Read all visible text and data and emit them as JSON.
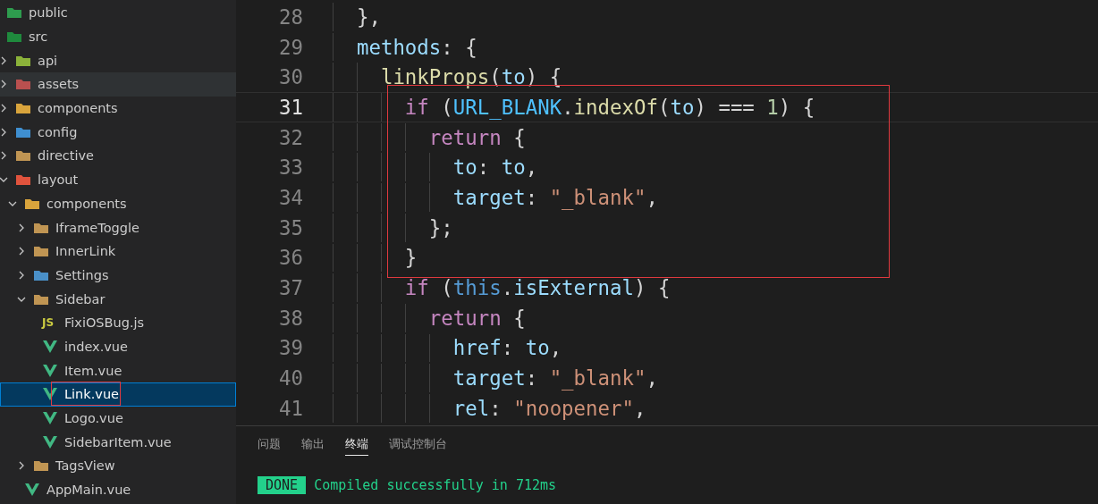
{
  "explorer": {
    "tree": [
      {
        "label": "public",
        "kind": "folder",
        "color": "#2e9c4e",
        "selected": false
      },
      {
        "label": "src",
        "kind": "folder",
        "color": "#1f8a3d",
        "selected": false,
        "children": [
          {
            "label": "api",
            "kind": "folder",
            "color": "#8bb23a",
            "expanded": false,
            "selected": false
          },
          {
            "label": "assets",
            "kind": "folder",
            "color": "#b9504f",
            "expanded": false,
            "selected": false,
            "hovered": true
          },
          {
            "label": "components",
            "kind": "folder",
            "color": "#d9a43c",
            "expanded": false,
            "selected": false
          },
          {
            "label": "config",
            "kind": "folder",
            "color": "#3f8fd0",
            "expanded": false,
            "selected": false
          },
          {
            "label": "directive",
            "kind": "folder",
            "color": "#c09553",
            "expanded": false,
            "selected": false
          },
          {
            "label": "layout",
            "kind": "folder",
            "color": "#e0533d",
            "expanded": true,
            "selected": false,
            "children": [
              {
                "label": "components",
                "kind": "folder",
                "color": "#d9a43c",
                "expanded": true,
                "selected": false,
                "children": [
                  {
                    "label": "IframeToggle",
                    "kind": "folder",
                    "color": "#c09553",
                    "expanded": false,
                    "selected": false
                  },
                  {
                    "label": "InnerLink",
                    "kind": "folder",
                    "color": "#c09553",
                    "expanded": false,
                    "selected": false
                  },
                  {
                    "label": "Settings",
                    "kind": "folder",
                    "color": "#4a90c8",
                    "expanded": false,
                    "selected": false
                  },
                  {
                    "label": "Sidebar",
                    "kind": "folder",
                    "color": "#c09553",
                    "expanded": true,
                    "selected": false,
                    "children": [
                      {
                        "label": "FixiOSBug.js",
                        "kind": "js",
                        "badge": "JS",
                        "selected": false
                      },
                      {
                        "label": "index.vue",
                        "kind": "vue",
                        "selected": false
                      },
                      {
                        "label": "Item.vue",
                        "kind": "vue",
                        "selected": false
                      },
                      {
                        "label": "Link.vue",
                        "kind": "vue",
                        "selected": true
                      },
                      {
                        "label": "Logo.vue",
                        "kind": "vue",
                        "selected": false
                      },
                      {
                        "label": "SidebarItem.vue",
                        "kind": "vue",
                        "selected": false
                      }
                    ]
                  },
                  {
                    "label": "TagsView",
                    "kind": "folder",
                    "color": "#c09553",
                    "expanded": false,
                    "selected": false
                  }
                ]
              },
              {
                "label": "AppMain.vue",
                "kind": "vue",
                "selected": false
              }
            ]
          }
        ]
      }
    ]
  },
  "editor": {
    "lines": [
      {
        "number": "28",
        "current": false,
        "tokens": [
          {
            "kind": "punct",
            "text": "},"
          }
        ]
      },
      {
        "number": "29",
        "current": false,
        "tokens": [
          {
            "kind": "prop",
            "text": "methods"
          },
          {
            "kind": "punct",
            "text": ": {"
          }
        ],
        "children": [
          {
            "number": "30",
            "current": false,
            "tokens": [
              {
                "kind": "func",
                "text": "linkProps"
              },
              {
                "kind": "punct",
                "text": "("
              },
              {
                "kind": "var",
                "text": "to"
              },
              {
                "kind": "punct",
                "text": ") {"
              }
            ],
            "children": [
              {
                "number": "31",
                "current": true,
                "tokens": [
                  {
                    "kind": "keyword",
                    "text": "if"
                  },
                  {
                    "kind": "punct",
                    "text": " ("
                  },
                  {
                    "kind": "const",
                    "text": "URL_BLANK"
                  },
                  {
                    "kind": "punct",
                    "text": "."
                  },
                  {
                    "kind": "func",
                    "text": "indexOf"
                  },
                  {
                    "kind": "punct",
                    "text": "("
                  },
                  {
                    "kind": "var",
                    "text": "to"
                  },
                  {
                    "kind": "punct",
                    "text": ") === "
                  },
                  {
                    "kind": "number",
                    "text": "1"
                  },
                  {
                    "kind": "punct",
                    "text": ") {"
                  }
                ],
                "children": [
                  {
                    "number": "32",
                    "current": false,
                    "tokens": [
                      {
                        "kind": "keyword",
                        "text": "return"
                      },
                      {
                        "kind": "punct",
                        "text": " {"
                      }
                    ],
                    "children": [
                      {
                        "number": "33",
                        "current": false,
                        "tokens": [
                          {
                            "kind": "prop",
                            "text": "to"
                          },
                          {
                            "kind": "punct",
                            "text": ": "
                          },
                          {
                            "kind": "var",
                            "text": "to"
                          },
                          {
                            "kind": "punct",
                            "text": ","
                          }
                        ]
                      },
                      {
                        "number": "34",
                        "current": false,
                        "tokens": [
                          {
                            "kind": "prop",
                            "text": "target"
                          },
                          {
                            "kind": "punct",
                            "text": ": "
                          },
                          {
                            "kind": "string",
                            "text": "\"_blank\""
                          },
                          {
                            "kind": "punct",
                            "text": ","
                          }
                        ]
                      }
                    ]
                  },
                  {
                    "number": "35",
                    "current": false,
                    "tokens": [
                      {
                        "kind": "punct",
                        "text": "};"
                      }
                    ]
                  }
                ]
              },
              {
                "number": "36",
                "current": false,
                "tokens": [
                  {
                    "kind": "punct",
                    "text": "}"
                  }
                ]
              },
              {
                "number": "37",
                "current": false,
                "tokens": [
                  {
                    "kind": "keyword",
                    "text": "if"
                  },
                  {
                    "kind": "punct",
                    "text": " ("
                  },
                  {
                    "kind": "this",
                    "text": "this"
                  },
                  {
                    "kind": "punct",
                    "text": "."
                  },
                  {
                    "kind": "var",
                    "text": "isExternal"
                  },
                  {
                    "kind": "punct",
                    "text": ") {"
                  }
                ],
                "children": [
                  {
                    "number": "38",
                    "current": false,
                    "tokens": [
                      {
                        "kind": "keyword",
                        "text": "return"
                      },
                      {
                        "kind": "punct",
                        "text": " {"
                      }
                    ],
                    "children": [
                      {
                        "number": "39",
                        "current": false,
                        "tokens": [
                          {
                            "kind": "prop",
                            "text": "href"
                          },
                          {
                            "kind": "punct",
                            "text": ": "
                          },
                          {
                            "kind": "var",
                            "text": "to"
                          },
                          {
                            "kind": "punct",
                            "text": ","
                          }
                        ]
                      },
                      {
                        "number": "40",
                        "current": false,
                        "tokens": [
                          {
                            "kind": "prop",
                            "text": "target"
                          },
                          {
                            "kind": "punct",
                            "text": ": "
                          },
                          {
                            "kind": "string",
                            "text": "\"_blank\""
                          },
                          {
                            "kind": "punct",
                            "text": ","
                          }
                        ]
                      },
                      {
                        "number": "41",
                        "current": false,
                        "tokens": [
                          {
                            "kind": "prop",
                            "text": "rel"
                          },
                          {
                            "kind": "punct",
                            "text": ": "
                          },
                          {
                            "kind": "string",
                            "text": "\"noopener\""
                          },
                          {
                            "kind": "punct",
                            "text": ","
                          }
                        ]
                      }
                    ]
                  }
                ]
              }
            ]
          }
        ]
      }
    ]
  },
  "panel": {
    "tabs": [
      {
        "label": "问题",
        "selected": false
      },
      {
        "label": "输出",
        "selected": false
      },
      {
        "label": "终端",
        "selected": true
      },
      {
        "label": "调试控制台",
        "selected": false
      }
    ],
    "terminal": {
      "badge": "DONE",
      "message": "Compiled successfully in 712ms"
    }
  }
}
